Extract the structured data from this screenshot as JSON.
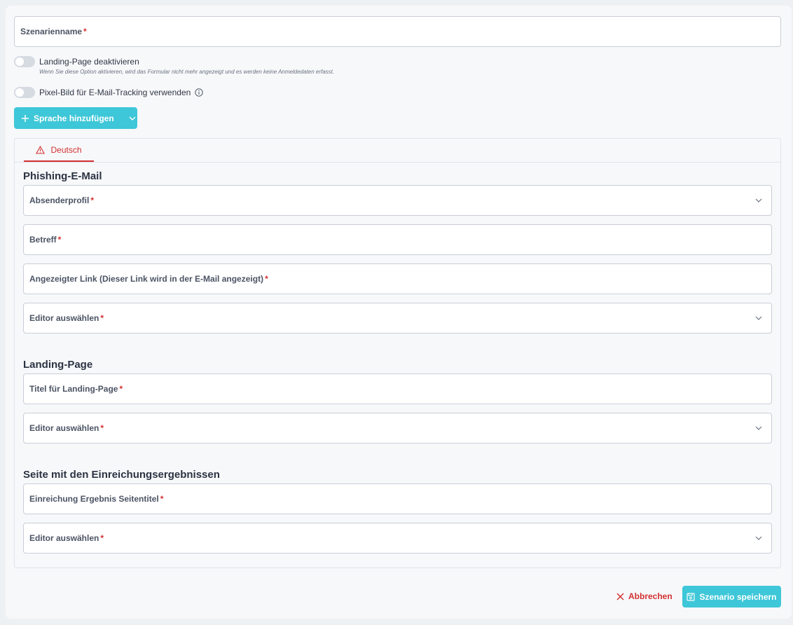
{
  "form": {
    "scenario_name_label": "Szenarienname",
    "required_mark": "*",
    "toggle_landing_label": "Landing-Page deaktivieren",
    "toggle_landing_hint": "Wenn Sie diese Option aktivieren, wird das Formular nicht mehr angezeigt und es werden keine Anmeldedaten erfasst.",
    "toggle_pixel_label": "Pixel-Bild für E-Mail-Tracking verwenden",
    "add_language_label": "Sprache hinzufügen"
  },
  "tabs": [
    {
      "label": "Deutsch"
    }
  ],
  "phishing": {
    "title": "Phishing-E-Mail",
    "sender_profile": "Absenderprofil",
    "subject": "Betreff",
    "displayed_link": "Angezeigter Link (Dieser Link wird in der E-Mail angezeigt)",
    "editor_select": "Editor auswählen"
  },
  "landing": {
    "title": "Landing-Page",
    "page_title": "Titel für Landing-Page",
    "editor_select": "Editor auswählen"
  },
  "results": {
    "title": "Seite mit den Einreichungsergebnissen",
    "page_title": "Einreichung Ergebnis Seitentitel",
    "editor_select": "Editor auswählen"
  },
  "actions": {
    "cancel": "Abbrechen",
    "save": "Szenario speichern"
  },
  "colors": {
    "accent": "#3ec7d8",
    "danger": "#d32f2f"
  }
}
